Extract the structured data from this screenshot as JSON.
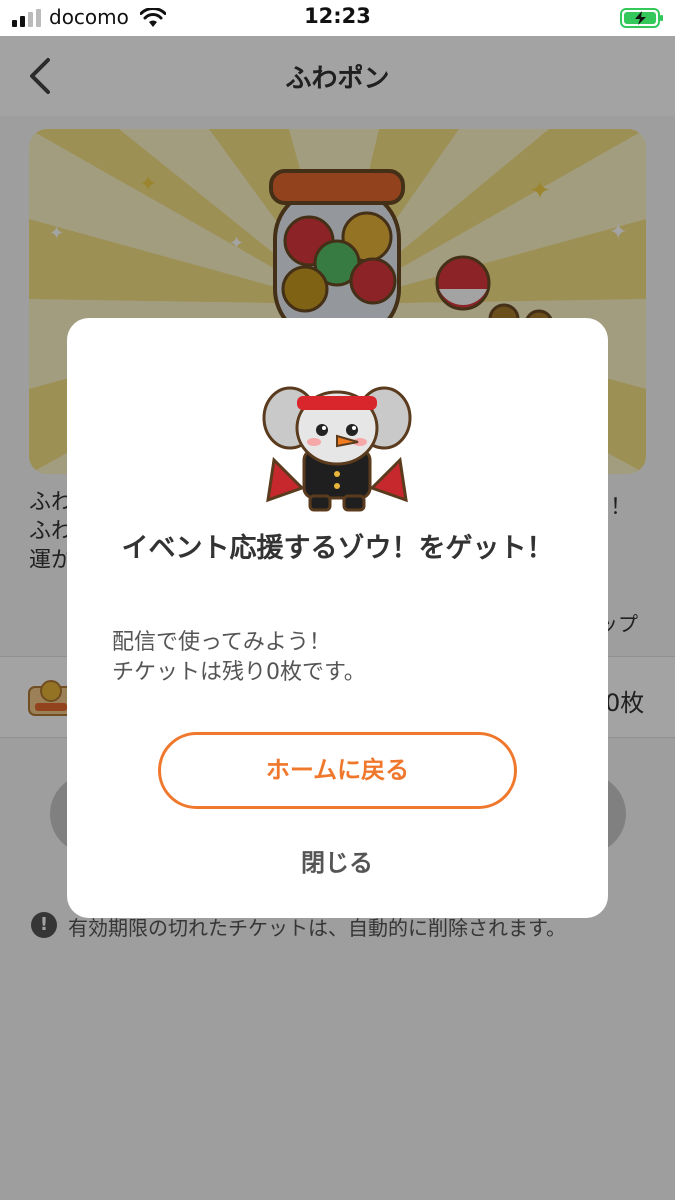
{
  "status_bar": {
    "carrier": "docomo",
    "time": "12:23",
    "signal_icon": "signal-bars-icon",
    "wifi_icon": "wifi-icon",
    "battery_icon": "battery-charging-icon"
  },
  "nav": {
    "title": "ふわポン",
    "back_icon": "chevron-left-icon"
  },
  "description": {
    "line1": "ふわ",
    "line2": "ふわ",
    "line3": "運が",
    "line1_tail": "！",
    "line4_tail": "ップ"
  },
  "ticket": {
    "icon": "fuwapon-ticket-icon",
    "count": "0枚"
  },
  "notice": {
    "icon": "exclamation-circle-icon",
    "text": "有効期限の切れたチケットは、自動的に削除されます。"
  },
  "modal": {
    "title": "イベント応援するゾウ！をゲット！",
    "body_line1": "配信で使ってみよう！",
    "body_line2": "チケットは残り0枚です。",
    "home_button": "ホームに戻る",
    "close_button": "閉じる",
    "mascot": "elephant-mascot-icon"
  },
  "colors": {
    "accent": "#f0782d",
    "overlay": "rgba(0,0,0,0.36)"
  }
}
